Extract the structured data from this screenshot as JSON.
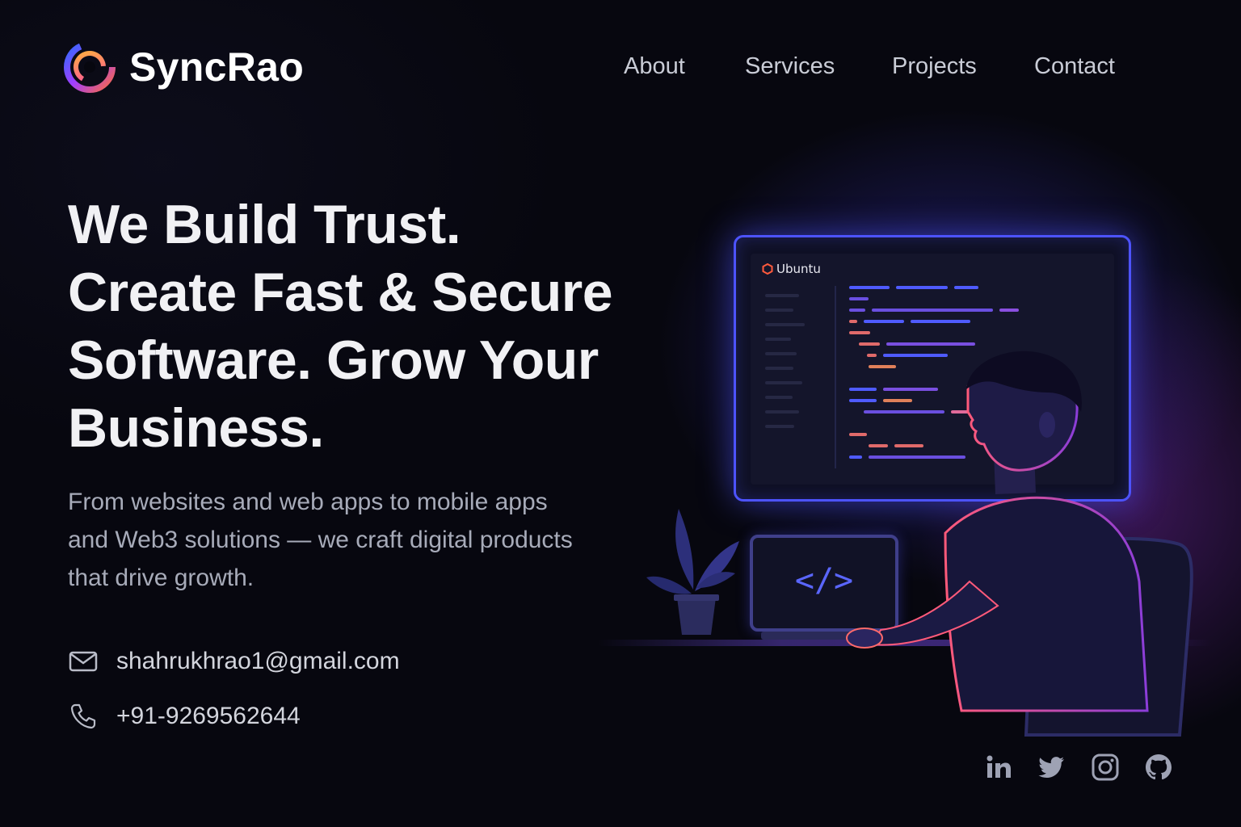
{
  "brand": {
    "name": "SyncRao",
    "logo_icon": "swirl-logo-icon"
  },
  "nav": {
    "items": [
      {
        "label": "About"
      },
      {
        "label": "Services"
      },
      {
        "label": "Projects"
      },
      {
        "label": "Contact"
      }
    ]
  },
  "hero": {
    "headline_lines": [
      "We Build Trust.",
      "Create Fast & Secure",
      "Software. Grow Your",
      "Business."
    ],
    "subcopy_lines": [
      "From websites and web apps to mobile apps",
      "and Web3 solutions — we craft digital products",
      "that drive growth."
    ]
  },
  "contact": {
    "email": {
      "icon": "mail-icon",
      "value": "shahrukhrao1@gmail.com"
    },
    "phone": {
      "icon": "phone-icon",
      "value": "+91-9269562644"
    }
  },
  "social": [
    {
      "icon": "linkedin-icon"
    },
    {
      "icon": "twitter-icon"
    },
    {
      "icon": "instagram-icon"
    },
    {
      "icon": "github-icon"
    }
  ],
  "illustration": {
    "screen_os_label": "Ubuntu",
    "laptop_glyph": "</>"
  },
  "colors": {
    "background": "#07070f",
    "accent_blue": "#4d53ff",
    "accent_purple": "#8b3dd9",
    "text_primary": "#f1f1f4",
    "text_muted": "#a7abb9",
    "nav_text": "#c9ccd6"
  }
}
